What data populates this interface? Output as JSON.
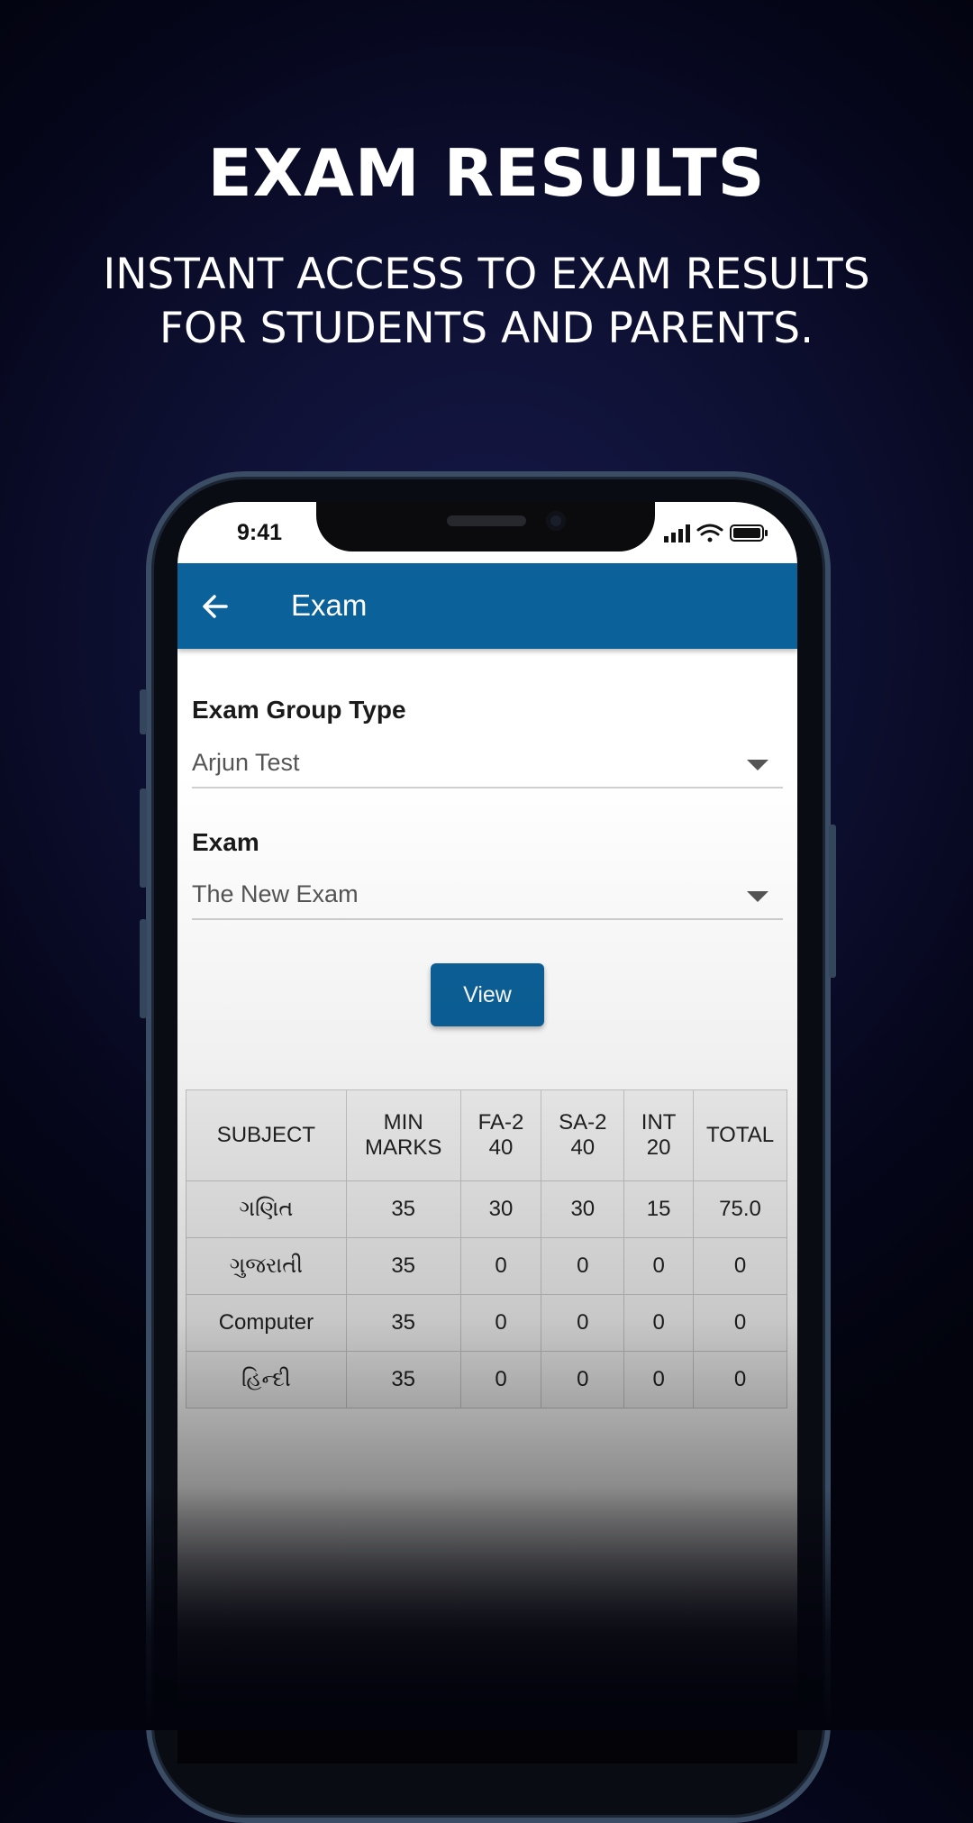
{
  "promo": {
    "headline": "EXAM RESULTS",
    "subline_line1": "INSTANT ACCESS TO EXAM RESULTS",
    "subline_line2": "FOR STUDENTS AND PARENTS."
  },
  "status_bar": {
    "time": "9:41",
    "icons": [
      "signal-icon",
      "wifi-icon",
      "battery-icon"
    ]
  },
  "app_bar": {
    "title": "Exam",
    "back_icon": "arrow-left-icon",
    "color": "#0b6199"
  },
  "form": {
    "group_type_label": "Exam Group Type",
    "group_type_value": "Arjun Test",
    "exam_label": "Exam",
    "exam_value": "The New Exam",
    "view_button": "View"
  },
  "results_table": {
    "headers": [
      {
        "line1": "SUBJECT",
        "line2": ""
      },
      {
        "line1": "MIN",
        "line2": "MARKS"
      },
      {
        "line1": "FA-2",
        "line2": "40"
      },
      {
        "line1": "SA-2",
        "line2": "40"
      },
      {
        "line1": "INT",
        "line2": "20"
      },
      {
        "line1": "TOTAL",
        "line2": ""
      }
    ],
    "rows": [
      [
        "ગણિત",
        "35",
        "30",
        "30",
        "15",
        "75.0"
      ],
      [
        "ગુજરાતી",
        "35",
        "0",
        "0",
        "0",
        "0"
      ],
      [
        "Computer",
        "35",
        "0",
        "0",
        "0",
        "0"
      ],
      [
        "હિન્દી",
        "35",
        "0",
        "0",
        "0",
        "0"
      ]
    ]
  }
}
